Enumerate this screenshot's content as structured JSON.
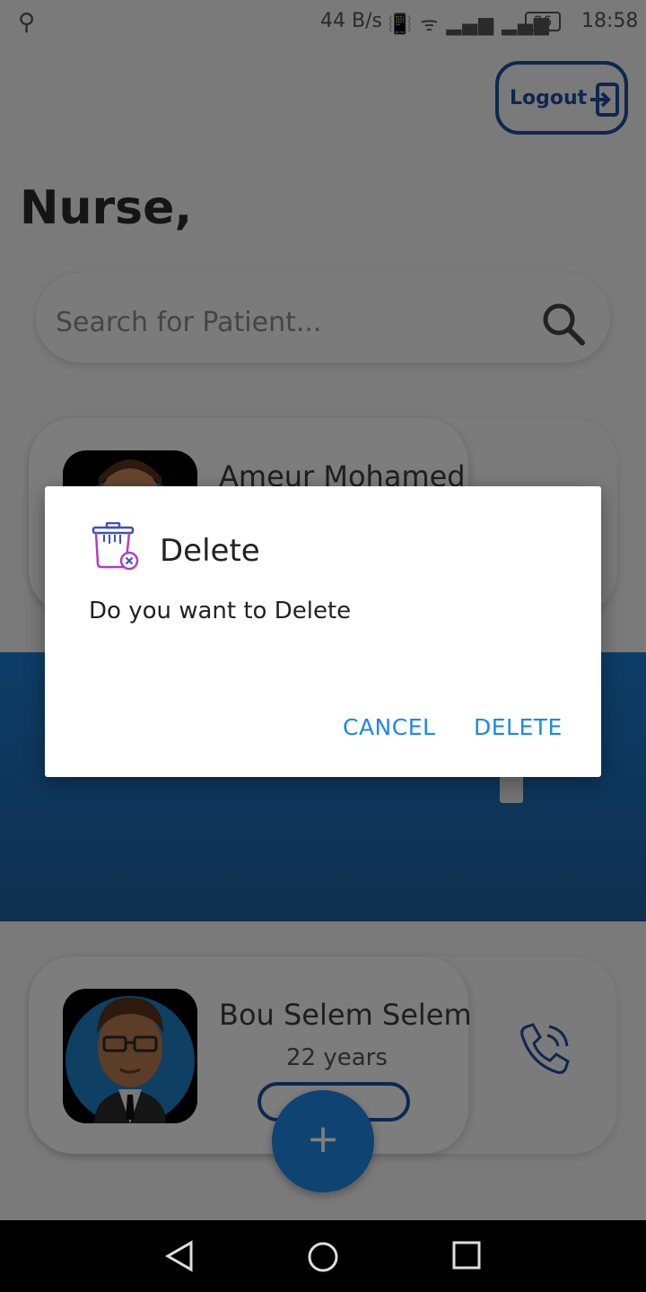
{
  "status_bar": {
    "usb_icon": "usb-icon",
    "net_speed": "44 B/s",
    "indicators": "vibrate wifi 4G 2G",
    "battery": "26",
    "time": "18:58"
  },
  "header": {
    "logout_label": "Logout",
    "greeting": "Nurse,"
  },
  "search": {
    "placeholder": "Search for Patient..."
  },
  "patients": [
    {
      "name": "Ameur Mohamed",
      "age": ""
    },
    {
      "name": "Bou Selem Selem",
      "age": "22 years"
    }
  ],
  "dialog": {
    "title": "Delete",
    "message": "Do you want to Delete",
    "cancel_label": "CANCEL",
    "delete_label": "DELETE"
  },
  "fab": {
    "label": "+"
  },
  "colors": {
    "accent": "#1e88e5",
    "brand_dark": "#1f4f9e",
    "band": "#1f5f9e"
  }
}
